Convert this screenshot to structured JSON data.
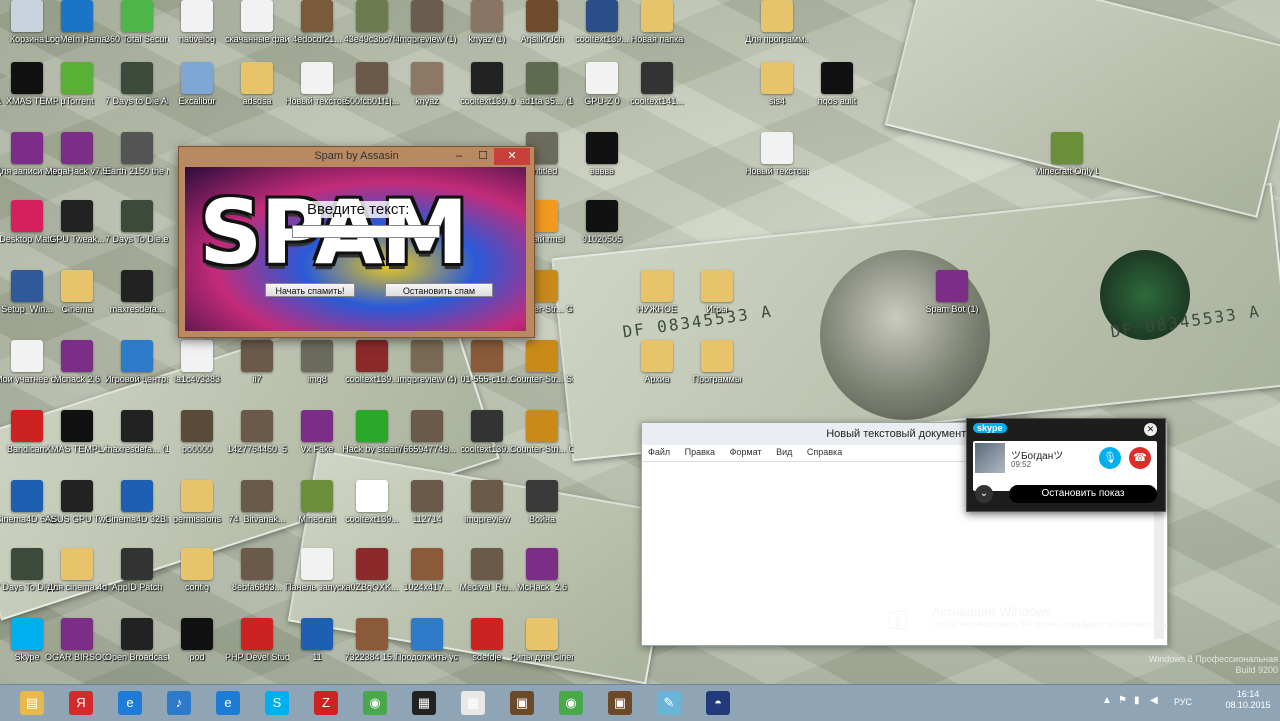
{
  "desktop_icons": [
    {
      "label": "Корзина",
      "color": "#c9d3de"
    },
    {
      "label": "LogMeIn Hamachi",
      "color": "#1a75c9"
    },
    {
      "label": "360 Total Security",
      "color": "#4cb648"
    },
    {
      "label": "nativelog",
      "color": "#f2f2f2"
    },
    {
      "label": "скачанные файлы",
      "color": "#f2f2f2"
    },
    {
      "label": "4edocdf21...",
      "color": "#7b5a3c"
    },
    {
      "label": "43e49c3bc7f4",
      "color": "#6c7b50"
    },
    {
      "label": "imgpreview (1)",
      "color": "#6b5d4d"
    },
    {
      "label": "knyaz (1)",
      "color": "#8a7463"
    },
    {
      "label": "ArjsilKrJch",
      "color": "#6e4b2c"
    },
    {
      "label": "cooltext139...",
      "color": "#2a4f88"
    },
    {
      "label": "Новая папка",
      "color": "#e7c46c"
    },
    {
      "label": "Для программ...",
      "color": "#e7c46c"
    },
    {
      "label": "A_XMAS TEMPLATE",
      "color": "#111"
    },
    {
      "label": "µTorrent",
      "color": "#5ab034"
    },
    {
      "label": "7 Days to Die Alpha",
      "color": "#3b4a3a"
    },
    {
      "label": "Excalibur",
      "color": "#7fa7d6"
    },
    {
      "label": "adsdsa",
      "color": "#e7c46c"
    },
    {
      "label": "Новый текстовы...",
      "color": "#f2f2f2"
    },
    {
      "label": "500fcb01f1j...",
      "color": "#6b5a4a"
    },
    {
      "label": "knyaz",
      "color": "#8d7866"
    },
    {
      "label": "cooltext139...",
      "color": "#222"
    },
    {
      "label": "0_ad1ta 35... (1)",
      "color": "#5f6a4f"
    },
    {
      "label": "GPU-Z 0",
      "color": "#f2f2f2"
    },
    {
      "label": "cooltext141...",
      "color": "#333"
    },
    {
      "label": "sis4",
      "color": "#e7c46c"
    },
    {
      "label": "hqos aulit",
      "color": "#111"
    },
    {
      "label": "Для записи ачивок в...",
      "color": "#7b2d88"
    },
    {
      "label": "MegaHack v7.5 (32bit)",
      "color": "#7b2d88"
    },
    {
      "label": "Earth 2150 the Moon...",
      "color": "#555"
    },
    {
      "label": "Untitled",
      "color": "#6c6c5c"
    },
    {
      "label": "ввввв",
      "color": "#111"
    },
    {
      "label": "Новый текстовый...",
      "color": "#f2f2f2"
    },
    {
      "label": "Minecraft Only Laun...",
      "color": "#6b8e3a"
    },
    {
      "label": "Desktop Mate",
      "color": "#d61f5d"
    },
    {
      "label": "GPU Tweak...",
      "color": "#222"
    },
    {
      "label": "7 Days To Die.exe",
      "color": "#3b4a3a"
    },
    {
      "label": "глный.rmsl",
      "color": "#f39a1e"
    },
    {
      "label": "91020505",
      "color": "#111"
    },
    {
      "label": "Setup_Win...",
      "color": "#2f5a9a"
    },
    {
      "label": "Cinema",
      "color": "#e7c46c"
    },
    {
      "label": "maxresdefa...",
      "color": "#222"
    },
    {
      "label": "Counter-Str... Global Offe...",
      "color": "#c98a1a"
    },
    {
      "label": "НУЖНОЕ",
      "color": "#e7c46c"
    },
    {
      "label": "Игры",
      "color": "#e7c46c"
    },
    {
      "label": "Spam Bot (1)",
      "color": "#7b2d88"
    },
    {
      "label": "Мои учатнее ответы Игры",
      "color": "#f2f2f2"
    },
    {
      "label": "Mcnack 2.6",
      "color": "#7b2d88"
    },
    {
      "label": "Игровой центр@Mail",
      "color": "#2c7ac8"
    },
    {
      "label": "la1c4v3383",
      "color": "#f2f2f2"
    },
    {
      "label": "ii7",
      "color": "#6b5a4a"
    },
    {
      "label": "img8",
      "color": "#6c6c5c"
    },
    {
      "label": "cooltext139...",
      "color": "#8a2a2a"
    },
    {
      "label": "imgpreview (4)",
      "color": "#7a6a55"
    },
    {
      "label": "01-555-c1d...",
      "color": "#8a5a3a"
    },
    {
      "label": "Counter-Str... Source",
      "color": "#c98a1a"
    },
    {
      "label": "Архив",
      "color": "#e7c46c"
    },
    {
      "label": "Программы",
      "color": "#e7c46c"
    },
    {
      "label": "Bandicam",
      "color": "#c22"
    },
    {
      "label": "XMAS TEMPLATE",
      "color": "#111"
    },
    {
      "label": "maxresdefa... (1)",
      "color": "#222"
    },
    {
      "label": "po0000",
      "color": "#5a4a3a"
    },
    {
      "label": "1427764460_5",
      "color": "#6b5a4a"
    },
    {
      "label": "Vx Fake",
      "color": "#7b2d88"
    },
    {
      "label": "Hack by steam",
      "color": "#2aa82a"
    },
    {
      "label": "7665947748...",
      "color": "#6b5a4a"
    },
    {
      "label": "cooltext139...",
      "color": "#333"
    },
    {
      "label": "Counter-Stri... Condition Z...",
      "color": "#c98a1a"
    },
    {
      "label": "Cinema4D 64Bit",
      "color": "#1d5fb3"
    },
    {
      "label": "ASUS GPU Tweak",
      "color": "#222"
    },
    {
      "label": "Cinema4D 32Bit",
      "color": "#1d5fb3"
    },
    {
      "label": "permissions",
      "color": "#e7c46c"
    },
    {
      "label": "74_Bitvanak...",
      "color": "#6b5a4a"
    },
    {
      "label": "Minecraft",
      "color": "#6b8e3a"
    },
    {
      "label": "cooltext139...",
      "color": "#fff"
    },
    {
      "label": "112714",
      "color": "#6b5a4a"
    },
    {
      "label": "imgpreview",
      "color": "#6b5a4a"
    },
    {
      "label": "Война",
      "color": "#3a3a3a"
    },
    {
      "label": "7 Days To Die.cfg",
      "color": "#3b4a3a"
    },
    {
      "label": "Для cinema 4d",
      "color": "#e7c46c"
    },
    {
      "label": "AppID Patch",
      "color": "#333"
    },
    {
      "label": "config",
      "color": "#e7c46c"
    },
    {
      "label": "8ebfa6833...",
      "color": "#6b5a4a"
    },
    {
      "label": "Панель запуска пр...",
      "color": "#f2f2f2"
    },
    {
      "label": "a0ZBgQXK...",
      "color": "#8a2a2a"
    },
    {
      "label": "1024x417...",
      "color": "#8a5a3a"
    },
    {
      "label": "Medival_Ru...",
      "color": "#6b5a4a"
    },
    {
      "label": "McHack_2.6",
      "color": "#7b2d88"
    },
    {
      "label": "Skype",
      "color": "#00aff0"
    },
    {
      "label": "OGAR BIRSOOU",
      "color": "#7b2d88"
    },
    {
      "label": "Open Broadcast...",
      "color": "#222"
    },
    {
      "label": "pod",
      "color": "#111"
    },
    {
      "label": "PHP Devel Studio 2010",
      "color": "#c22"
    },
    {
      "label": "11",
      "color": "#1d5fb3"
    },
    {
      "label": "7322384 15...",
      "color": "#8a5a3a"
    },
    {
      "label": "Продолжить установку...",
      "color": "#2c7ac8"
    },
    {
      "label": "sdefdje",
      "color": "#c22"
    },
    {
      "label": "Рипы для Cinema 4D",
      "color": "#e7c46c"
    }
  ],
  "bill_text": [
    "DF 08345533 A",
    "DF 08345533 A",
    "DF 08345533 A"
  ],
  "spam_window": {
    "title": "Spam by Assasin",
    "logo": "SPAM",
    "prompt": "Введите текст:",
    "input_value": "",
    "start_button": "Начать спамить!",
    "stop_button": "Остановить спам"
  },
  "notepad": {
    "title": "Новый текстовый документ (2)",
    "menu": [
      "Файл",
      "Правка",
      "Формат",
      "Вид",
      "Справка"
    ],
    "text": ""
  },
  "skype_call": {
    "logo": "skype",
    "contact": "ツБогданツ",
    "duration": "09:52",
    "stop_label": "Остановить показ"
  },
  "activation": {
    "title": "Активация Windows",
    "subtitle": "Чтобы активировать Windows, перейдите в компьютера."
  },
  "edition": {
    "line1": "Windows 8 Профессиональная",
    "line2": "Build 9200"
  },
  "taskbar": {
    "apps": [
      {
        "name": "file-explorer",
        "glyph": "▤",
        "color": "#e8b84a"
      },
      {
        "name": "yandex-browser",
        "glyph": "Я",
        "color": "#d42a2a"
      },
      {
        "name": "internet-explorer",
        "glyph": "e",
        "color": "#1e7bd6"
      },
      {
        "name": "media-player",
        "glyph": "♪",
        "color": "#2c7ac8"
      },
      {
        "name": "internet-explorer-2",
        "glyph": "e",
        "color": "#1e7bd6"
      },
      {
        "name": "skype",
        "glyph": "S",
        "color": "#00aff0"
      },
      {
        "name": "filezilla",
        "glyph": "Z",
        "color": "#c22"
      },
      {
        "name": "chrome",
        "glyph": "◉",
        "color": "#4aa84a"
      },
      {
        "name": "video-editor",
        "glyph": "▦",
        "color": "#222"
      },
      {
        "name": "app-grid",
        "glyph": "▦",
        "color": "#e8e8e8"
      },
      {
        "name": "minecraft",
        "glyph": "▣",
        "color": "#6b4a2a"
      },
      {
        "name": "chrome-2",
        "glyph": "◉",
        "color": "#4aa84a"
      },
      {
        "name": "minecraft-2",
        "glyph": "▣",
        "color": "#6b4a2a"
      },
      {
        "name": "notepad",
        "glyph": "✎",
        "color": "#6ab4d8"
      },
      {
        "name": "spam-app",
        "glyph": "◓",
        "color": "#223a7a"
      }
    ],
    "language": "РУС",
    "time": "16:14",
    "date": "08.10.2015"
  }
}
